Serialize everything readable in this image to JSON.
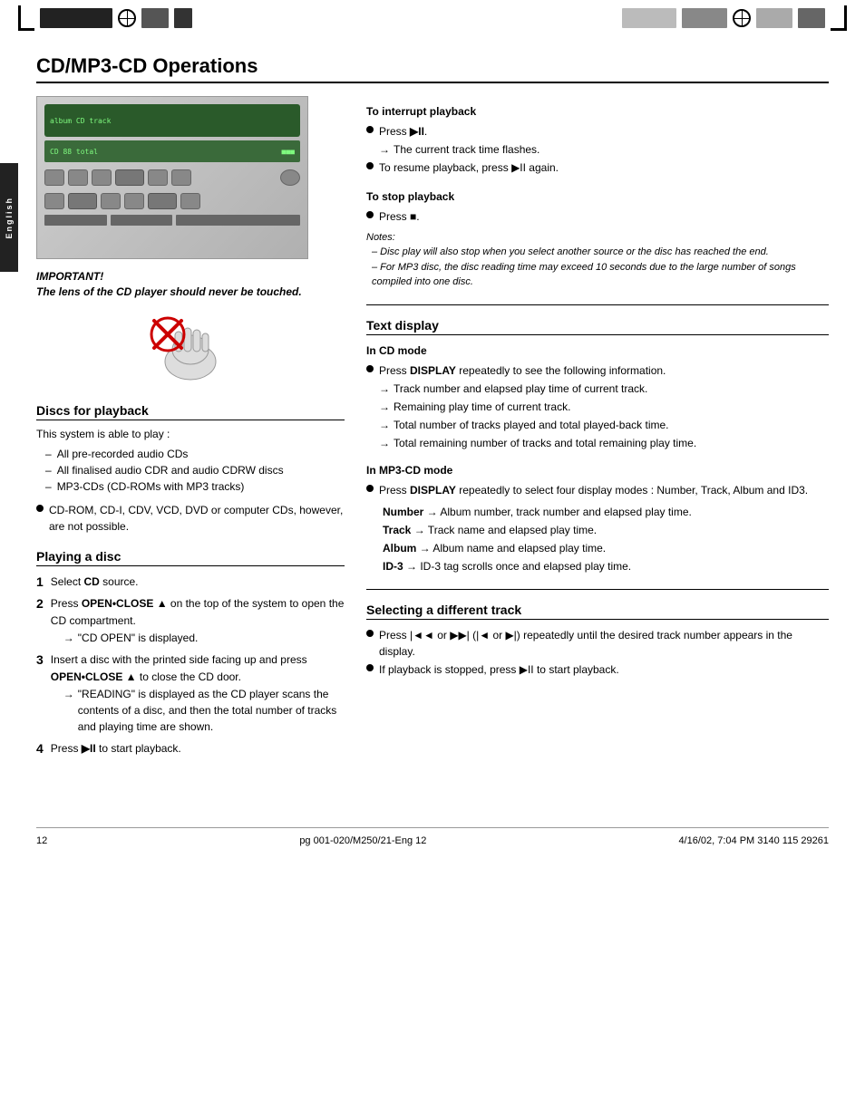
{
  "header": {
    "title": "CD/MP3-CD Operations"
  },
  "side_tab": {
    "label": "English"
  },
  "important_section": {
    "title": "IMPORTANT!",
    "text": "The lens of the CD player should never be touched."
  },
  "discs_for_playback": {
    "title": "Discs for playback",
    "intro": "This system is able to play :",
    "dash_items": [
      "All pre-recorded audio CDs",
      "All finalised audio CDR and audio CDRW discs",
      "MP3-CDs (CD-ROMs with MP3 tracks)"
    ],
    "bullet_text": "CD-ROM, CD-I, CDV, VCD, DVD or computer CDs, however, are not possible."
  },
  "playing_a_disc": {
    "title": "Playing a disc",
    "steps": [
      {
        "num": "1",
        "text": "Select CD source."
      },
      {
        "num": "2",
        "text": "Press OPEN•CLOSE ▲ on the top of the system to open the CD compartment.",
        "arrow": "\"CD OPEN\" is displayed."
      },
      {
        "num": "3",
        "text": "Insert a disc with the printed side facing up and press OPEN•CLOSE ▲ to close the CD door.",
        "arrow": "\"READING\" is displayed as the CD player scans the contents of a disc, and then the total number of tracks and playing time are shown."
      },
      {
        "num": "4",
        "text": "Press ▶II to start playback."
      }
    ]
  },
  "interrupt_playback": {
    "title": "To interrupt playback",
    "bullet": "Press ▶II.",
    "arrow1": "The current track time flashes.",
    "bullet2": "To resume playback, press ▶II again."
  },
  "stop_playback": {
    "title": "To stop playback",
    "bullet": "Press ■.",
    "notes_title": "Notes:",
    "notes": [
      "– Disc play will also stop when you select another source or the disc has reached the end.",
      "– For MP3 disc, the disc reading time may exceed 10 seconds due to the large number of songs compiled into one disc."
    ]
  },
  "text_display": {
    "title": "Text display",
    "cd_mode_title": "In CD mode",
    "cd_mode_bullet": "Press DISPLAY repeatedly to see the following information.",
    "cd_mode_arrows": [
      "Track number and elapsed play time of current track.",
      "Remaining play time of current track.",
      "Total number of tracks played and total played-back time.",
      "Total remaining number of tracks and total remaining play time."
    ],
    "mp3_mode_title": "In MP3-CD mode",
    "mp3_mode_bullet": "Press DISPLAY repeatedly to select four display modes : Number, Track, Album and ID3.",
    "mp3_mode_items": [
      {
        "label": "Number",
        "arrow": "Album number, track number and elapsed play time."
      },
      {
        "label": "Track",
        "arrow": "Track name and elapsed play time."
      },
      {
        "label": "Album",
        "arrow": "Album name and elapsed play time."
      },
      {
        "label": "ID-3",
        "arrow": "ID-3 tag scrolls once and elapsed play time."
      }
    ]
  },
  "selecting_track": {
    "title": "Selecting a different track",
    "bullet1": "Press |◄◄ or ▶▶| (|◄ or ▶|) repeatedly until the desired track number appears in the display.",
    "bullet2": "If playback is stopped, press ▶II to start playback."
  },
  "footer": {
    "left": "12",
    "center": "pg 001-020/M250/21-Eng                    12",
    "right": "4/16/02, 7:04 PM  3140 115 29261"
  }
}
